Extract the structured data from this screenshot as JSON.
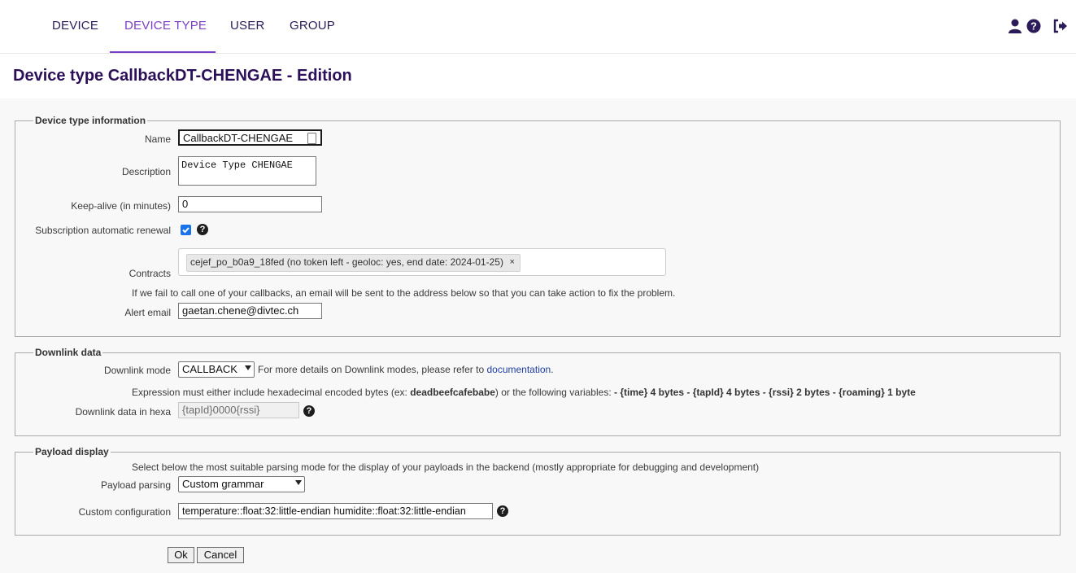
{
  "nav": {
    "tabs": [
      {
        "label": "DEVICE"
      },
      {
        "label": "DEVICE TYPE"
      },
      {
        "label": "USER"
      },
      {
        "label": "GROUP"
      }
    ],
    "icons": [
      "user-icon",
      "help-circle-icon",
      "sign-out-icon"
    ]
  },
  "page": {
    "title": "Device type CallbackDT-CHENGAE - Edition"
  },
  "info": {
    "legend": "Device type information",
    "name_label": "Name",
    "name_value": "CallbackDT-CHENGAE",
    "description_label": "Description",
    "description_value": "Device Type CHENGAE",
    "keepalive_label": "Keep-alive (in minutes)",
    "keepalive_value": "0",
    "renewal_label": "Subscription automatic renewal",
    "renewal_checked": true,
    "contracts_label": "Contracts",
    "contract_tag": "cejef_po_b0a9_18fed (no token left - geoloc: yes, end date: 2024-01-25)",
    "contract_remove": "×",
    "alert_note": "If we fail to call one of your callbacks, an email will be sent to the address below so that you can take action to fix the problem.",
    "alert_label": "Alert email",
    "alert_value": "gaetan.chene@divtec.ch"
  },
  "downlink": {
    "legend": "Downlink data",
    "mode_label": "Downlink mode",
    "mode_value": "CALLBACK",
    "mode_note_prefix": "For more details on Downlink modes, please refer to",
    "mode_note_link": "documentation",
    "mode_note_suffix": ".",
    "expr_prefix": "Expression must either include hexadecimal encoded bytes (ex:",
    "expr_example": "deadbeefcafebabe",
    "expr_middle": ") or the following variables:",
    "expr_vars": "- {time} 4 bytes - {tapId} 4 bytes - {rssi} 2 bytes - {roaming} 1 byte",
    "hexa_label": "Downlink data in hexa",
    "hexa_value": "{tapId}0000{rssi}"
  },
  "payload": {
    "legend": "Payload display",
    "note": "Select below the most suitable parsing mode for the display of your payloads in the backend (mostly appropriate for debugging and development)",
    "parsing_label": "Payload parsing",
    "parsing_value": "Custom grammar",
    "config_label": "Custom configuration",
    "config_value": "temperature::float:32:little-endian humidite::float:32:little-endian"
  },
  "actions": {
    "ok_label": "Ok",
    "cancel_label": "Cancel"
  },
  "colors": {
    "accent": "#7a3fc4",
    "nav_text": "#2b1c59",
    "title": "#2b1059"
  }
}
